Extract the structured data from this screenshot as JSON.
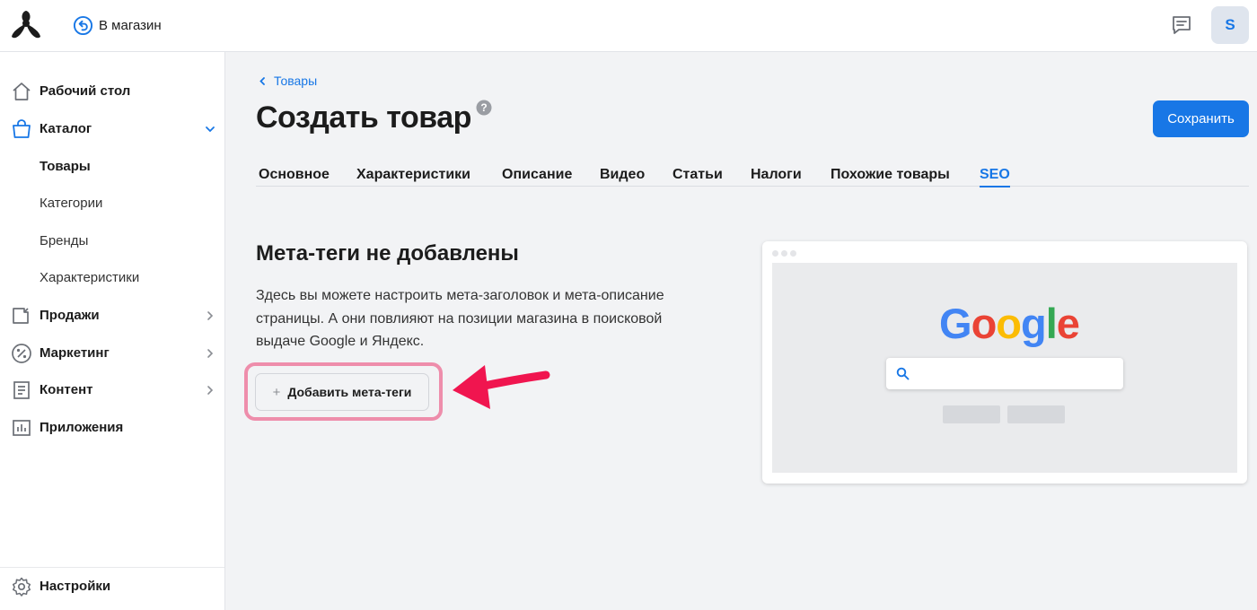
{
  "header": {
    "back_to_store": "В магазин",
    "avatar_letter": "S"
  },
  "sidebar": {
    "items": [
      {
        "label": "Рабочий стол"
      },
      {
        "label": "Каталог"
      },
      {
        "label": "Товары"
      },
      {
        "label": "Категории"
      },
      {
        "label": "Бренды"
      },
      {
        "label": "Характеристики"
      },
      {
        "label": "Продажи"
      },
      {
        "label": "Маркетинг"
      },
      {
        "label": "Контент"
      },
      {
        "label": "Приложения"
      }
    ],
    "settings": "Настройки"
  },
  "main": {
    "breadcrumb": "Товары",
    "title": "Создать товар",
    "save_label": "Сохранить",
    "tabs": [
      {
        "label": "Основное"
      },
      {
        "label": "Характеристики"
      },
      {
        "label": "Описание"
      },
      {
        "label": "Видео"
      },
      {
        "label": "Статьи"
      },
      {
        "label": "Налоги"
      },
      {
        "label": "Похожие товары"
      },
      {
        "label": "SEO"
      }
    ],
    "active_tab": "SEO",
    "empty_title": "Мета-теги не добавлены",
    "empty_description": "Здесь вы можете настроить мета-заголовок и мета-описание страницы. А они повлияют на позиции магазина в поисковой выдаче Google и Яндекс.",
    "add_button": "Добавить мета-теги"
  },
  "preview": {
    "logo_letters": [
      "G",
      "o",
      "o",
      "g",
      "l",
      "e"
    ]
  },
  "colors": {
    "accent": "#1877e6",
    "highlight": "#ee8dab",
    "arrow": "#f0154f",
    "google_blue": "#4285f4",
    "google_red": "#ea4335",
    "google_yellow": "#fbbc05",
    "google_green": "#34a853"
  }
}
